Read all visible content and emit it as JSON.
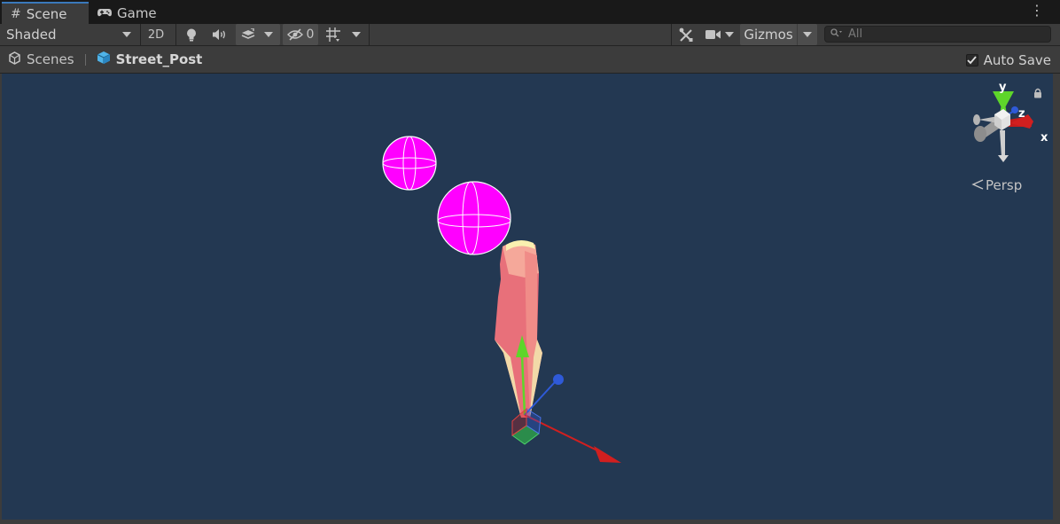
{
  "tabs": [
    {
      "label": "Scene",
      "icon": "grid-hash-icon",
      "active": true
    },
    {
      "label": "Game",
      "icon": "gamepad-icon",
      "active": false
    }
  ],
  "toolbar": {
    "draw_mode": "Shaded",
    "mode_2d": "2D",
    "hidden_count": "0",
    "gizmos_label": "Gizmos",
    "search_placeholder": "All"
  },
  "breadcrumb": {
    "root": "Scenes",
    "prefab": "Street_Post"
  },
  "auto_save": {
    "label": "Auto Save",
    "checked": true
  },
  "scene_gizmo": {
    "axis_y": "y",
    "axis_z": "z",
    "axis_x": "x",
    "projection": "Persp"
  },
  "colors": {
    "viewport_bg": "#233852",
    "panel_bg": "#3c3c3c",
    "accent_tab": "#3a79bb",
    "sphere": "#ff00ff",
    "post": "#e8707a",
    "axis_x": "#d11f1f",
    "axis_y": "#5ed62a",
    "axis_z": "#2f5ad8"
  }
}
